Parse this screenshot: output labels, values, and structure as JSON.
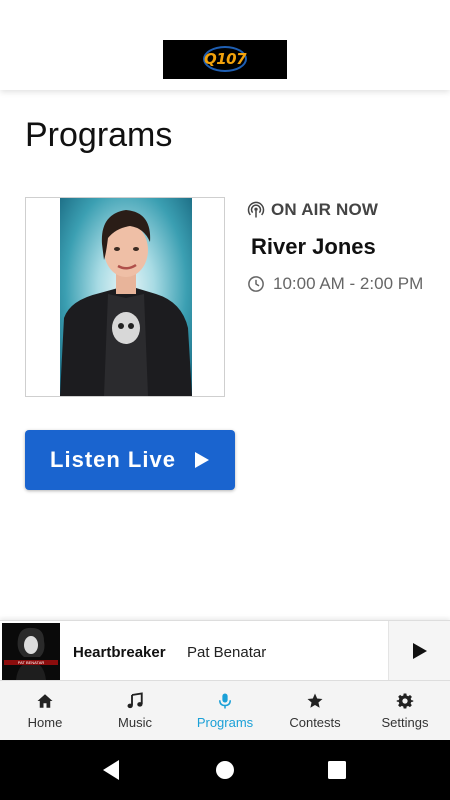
{
  "header": {
    "logo_text": "Q107"
  },
  "page": {
    "title": "Programs"
  },
  "program": {
    "on_air_label": "ON AIR NOW",
    "host_name": "River Jones",
    "time_range": "10:00 AM - 2:00 PM"
  },
  "listen_button": {
    "label": "Listen Live"
  },
  "now_playing": {
    "title": "Heartbreaker",
    "artist": "Pat Benatar",
    "art_text": "PAT BENATAR"
  },
  "tabs": [
    {
      "label": "Home",
      "icon": "home-icon"
    },
    {
      "label": "Music",
      "icon": "music-note-icon"
    },
    {
      "label": "Programs",
      "icon": "microphone-icon",
      "active": true
    },
    {
      "label": "Contests",
      "icon": "star-icon"
    },
    {
      "label": "Settings",
      "icon": "gear-icon"
    }
  ],
  "colors": {
    "accent": "#1a64cf",
    "active_tab": "#1ba0d7",
    "logo_gold": "#f2a20c"
  }
}
